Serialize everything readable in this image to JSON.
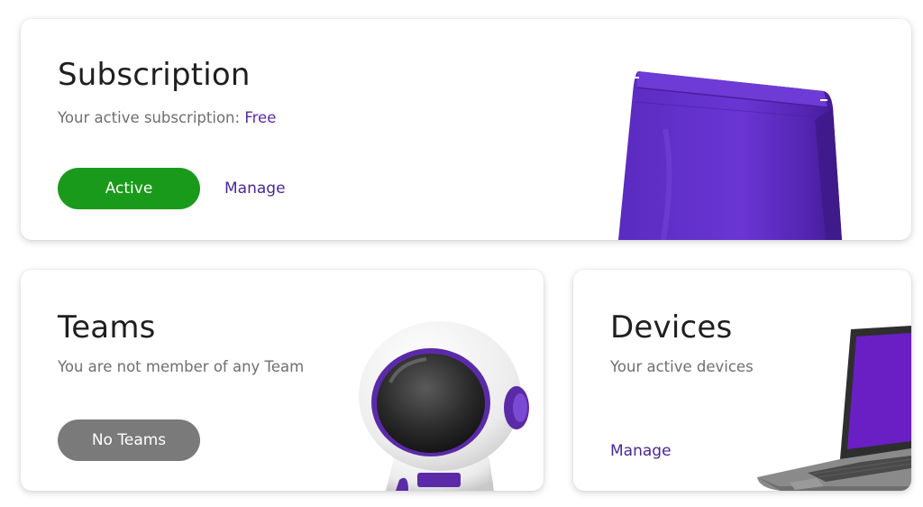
{
  "subscription": {
    "title": "Subscription",
    "subtitle_prefix": "Your active subscription: ",
    "plan": "Free",
    "status_button": "Active",
    "manage_link": "Manage",
    "illustration_icon": "coffee-bag-icon"
  },
  "teams": {
    "title": "Teams",
    "subtitle": "You are not member of any Team",
    "status_button": "No Teams",
    "illustration_icon": "astronaut-icon"
  },
  "devices": {
    "title": "Devices",
    "subtitle": "Your active devices",
    "manage_link": "Manage",
    "illustration_icon": "laptop-icon"
  },
  "colors": {
    "active_green": "#1a9a1a",
    "inactive_gray": "#7a7a7a",
    "brand_purple": "#5b2aa8"
  }
}
